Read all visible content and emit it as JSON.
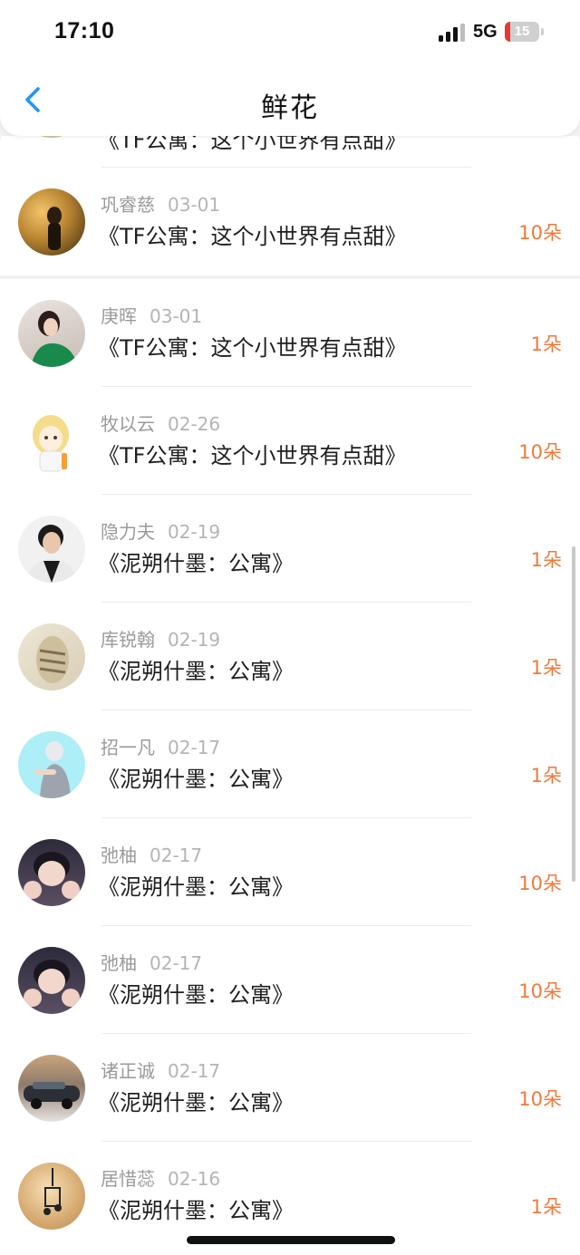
{
  "status": {
    "time": "17:10",
    "network": "5G",
    "battery": "15",
    "battery_level": 0.15
  },
  "nav": {
    "title": "鲜花",
    "back_icon": "chevron-left-icon",
    "accent_color": "#2196f3"
  },
  "partial": {
    "work": "《TF公寓：这个小世界有点甜》"
  },
  "records": [
    {
      "user": "巩睿慈",
      "date": "03-01",
      "work": "《TF公寓：这个小世界有点甜》",
      "flowers": "10朵"
    },
    {
      "user": "庚晖",
      "date": "03-01",
      "work": "《TF公寓：这个小世界有点甜》",
      "flowers": "1朵"
    },
    {
      "user": "牧以云",
      "date": "02-26",
      "work": "《TF公寓：这个小世界有点甜》",
      "flowers": "10朵"
    },
    {
      "user": "隐力夫",
      "date": "02-19",
      "work": "《泥朔什墨：公寓》",
      "flowers": "1朵"
    },
    {
      "user": "库锐翰",
      "date": "02-19",
      "work": "《泥朔什墨：公寓》",
      "flowers": "1朵"
    },
    {
      "user": "招一凡",
      "date": "02-17",
      "work": "《泥朔什墨：公寓》",
      "flowers": "1朵"
    },
    {
      "user": "弛柚",
      "date": "02-17",
      "work": "《泥朔什墨：公寓》",
      "flowers": "10朵"
    },
    {
      "user": "弛柚",
      "date": "02-17",
      "work": "《泥朔什墨：公寓》",
      "flowers": "10朵"
    },
    {
      "user": "诸正诚",
      "date": "02-17",
      "work": "《泥朔什墨：公寓》",
      "flowers": "10朵"
    },
    {
      "user": "居惜蕊",
      "date": "02-16",
      "work": "《泥朔什墨：公寓》",
      "flowers": "1朵"
    }
  ],
  "colors": {
    "flower_count": "#f07a3a",
    "background": "#f2f2f2"
  }
}
